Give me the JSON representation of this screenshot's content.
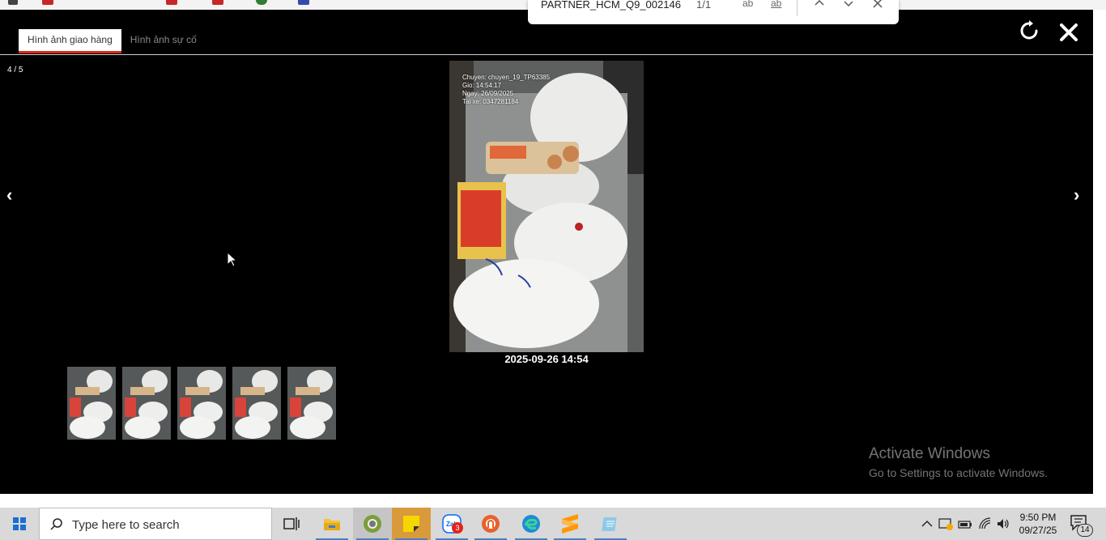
{
  "find_bar": {
    "query": "PARTNER_HCM_Q9_002146",
    "count": "1/1",
    "opt_match_case": "ab",
    "opt_whole_word": "ab"
  },
  "modal": {
    "tabs": [
      {
        "label": "Hình ảnh giao hàng",
        "active": true
      },
      {
        "label": "Hình ảnh sự cố",
        "active": false
      }
    ],
    "counter": "4 / 5",
    "prev_glyph": "‹",
    "next_glyph": "›",
    "photo": {
      "stamp_lines": [
        "Chuyen: chuyen_19_TP63385",
        "Gio: 14:54:17",
        "Ngay: 26/09/2025",
        "Tai xe: 0347281184"
      ],
      "caption": "2025-09-26 14:54"
    },
    "thumbnail_count": 5
  },
  "watermark": {
    "title": "Activate Windows",
    "subtitle": "Go to Settings to activate Windows."
  },
  "taskbar": {
    "search_placeholder": "Type here to search",
    "zalo_badge": "3",
    "time": "9:50 PM",
    "date": "09/27/25",
    "notification_count": "14",
    "apps": [
      "task-view-icon",
      "file-explorer-icon",
      "chrome-canary-icon",
      "sticky-notes-icon",
      "zalo-icon",
      "anydesk-icon",
      "edge-icon",
      "sublime-icon",
      "notepad-icon"
    ]
  },
  "colors": {
    "active_tab_underline": "#d9261c",
    "modal_bg": "#000000",
    "taskbar_bg": "#d9d9d9"
  }
}
